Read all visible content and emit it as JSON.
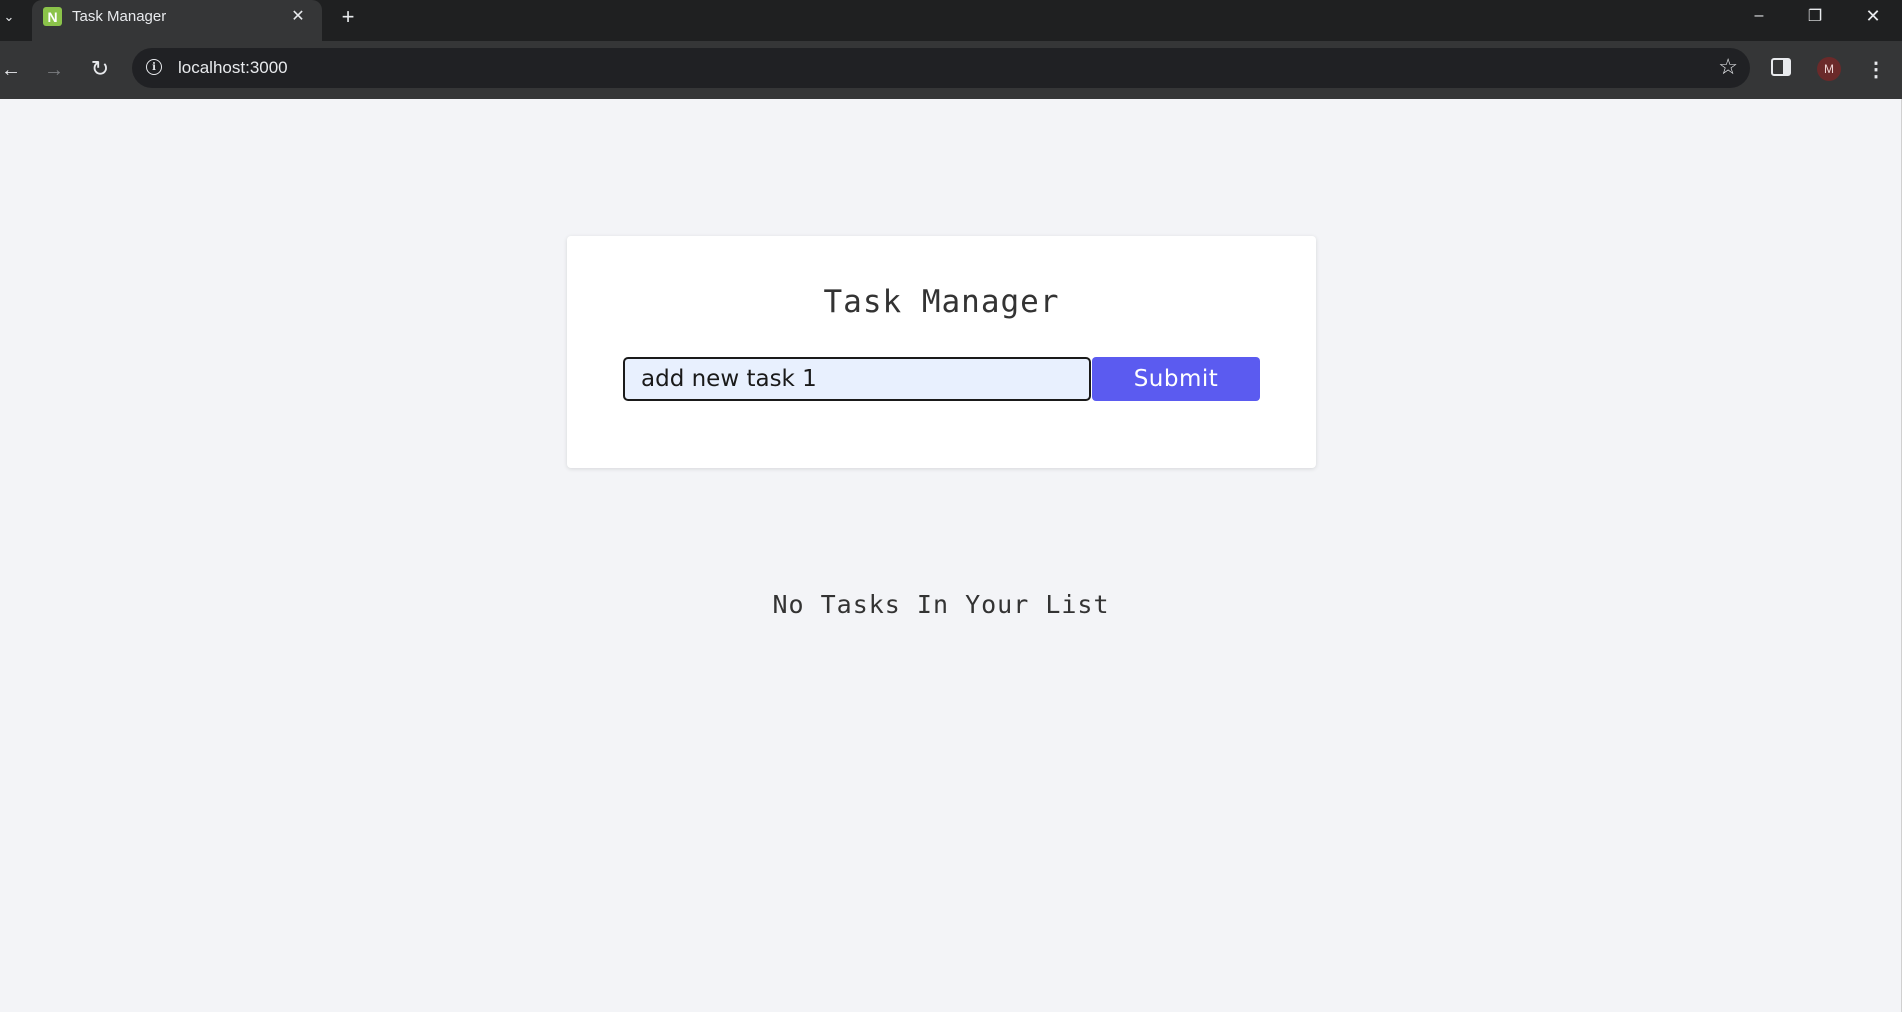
{
  "browser": {
    "tab_title": "Task Manager",
    "favicon_letter": "N",
    "url": "localhost:3000",
    "profile_initial": "M"
  },
  "app": {
    "title": "Task Manager",
    "input": {
      "value": "add new task 1",
      "placeholder": ""
    },
    "submit_label": "Submit",
    "empty_message": "No Tasks In Your List"
  },
  "colors": {
    "accent": "#5b5bf0",
    "page_background": "#f3f4f7",
    "card_background": "#ffffff",
    "input_background": "#e8f0fe"
  },
  "icons": {
    "tab_list": "chevron-down-icon",
    "tab_close": "close-icon",
    "new_tab": "plus-icon",
    "back": "back-arrow-icon",
    "forward": "forward-arrow-icon",
    "reload": "reload-icon",
    "site_info": "info-icon",
    "bookmark": "star-icon",
    "side_panel": "side-panel-icon",
    "menu": "kebab-menu-icon",
    "minimize": "minimize-icon",
    "restore": "restore-icon",
    "close_window": "close-icon"
  }
}
